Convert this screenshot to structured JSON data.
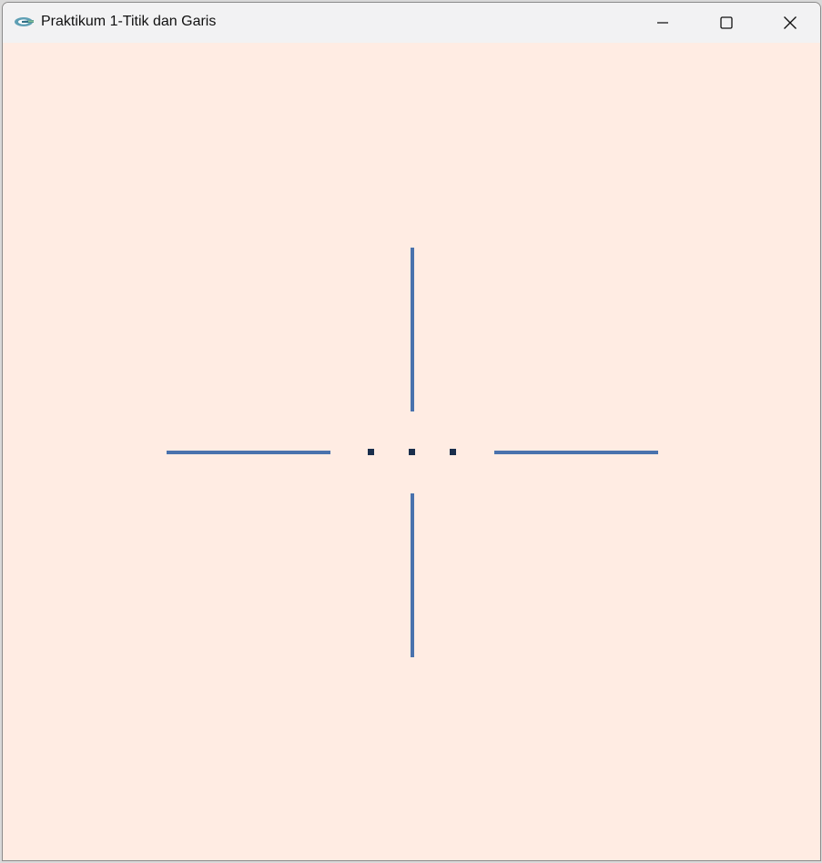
{
  "window": {
    "title": "Praktikum 1-Titik dan Garis",
    "app_icon": "opengl-glut-icon",
    "controls": [
      "minimize-icon",
      "maximize-icon",
      "close-icon"
    ]
  },
  "canvas": {
    "background_color": "#ffece3",
    "line_color": "#4a72ad",
    "point_color": "#1a2e4c",
    "points_count": 3,
    "lines_count": 4
  }
}
